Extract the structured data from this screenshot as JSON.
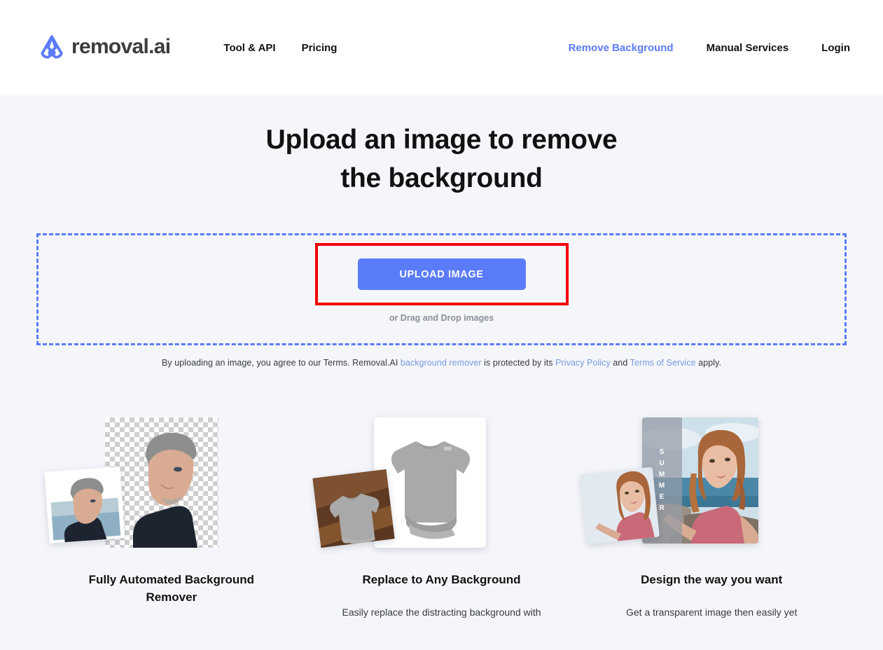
{
  "header": {
    "logo": {
      "text": "removal.ai",
      "icon": "removal-ai-logo-icon"
    },
    "nav_primary": [
      {
        "label": "Tool & API"
      },
      {
        "label": "Pricing"
      }
    ],
    "nav_secondary": [
      {
        "label": "Remove Background",
        "accent": true
      },
      {
        "label": "Manual Services",
        "accent": false
      },
      {
        "label": "Login",
        "accent": false
      }
    ]
  },
  "hero": {
    "title_line1": "Upload an image to remove",
    "title_line2": "the background"
  },
  "dropzone": {
    "upload_button_label": "UPLOAD IMAGE",
    "drag_hint": "or Drag and Drop images",
    "highlight_color": "#f40000",
    "border_color": "#5b7cfa"
  },
  "legal": {
    "part1": "By uploading an image, you agree to our Terms. Removal.AI ",
    "link1": "background remover",
    "part2": " is protected by its ",
    "link2": "Privacy Policy",
    "part3": " and ",
    "link3": "Terms of Service",
    "part4": " apply."
  },
  "features": [
    {
      "title": "Fully Automated Background Remover",
      "description": "",
      "art": "man-portrait-cutout"
    },
    {
      "title": "Replace to Any Background",
      "description": "Easily replace the distracting background with",
      "art": "tshirt-mockup"
    },
    {
      "title": "Design the way you want",
      "description": "Get a transparent image then easily yet",
      "art": "woman-summer-photo",
      "overlay_text": [
        "S",
        "U",
        "M",
        "M",
        "E",
        "R"
      ]
    }
  ],
  "colors": {
    "accent": "#5b7cfa",
    "page_background": "#f5f6fa",
    "header_background": "#ffffff",
    "highlight": "#f40000"
  }
}
